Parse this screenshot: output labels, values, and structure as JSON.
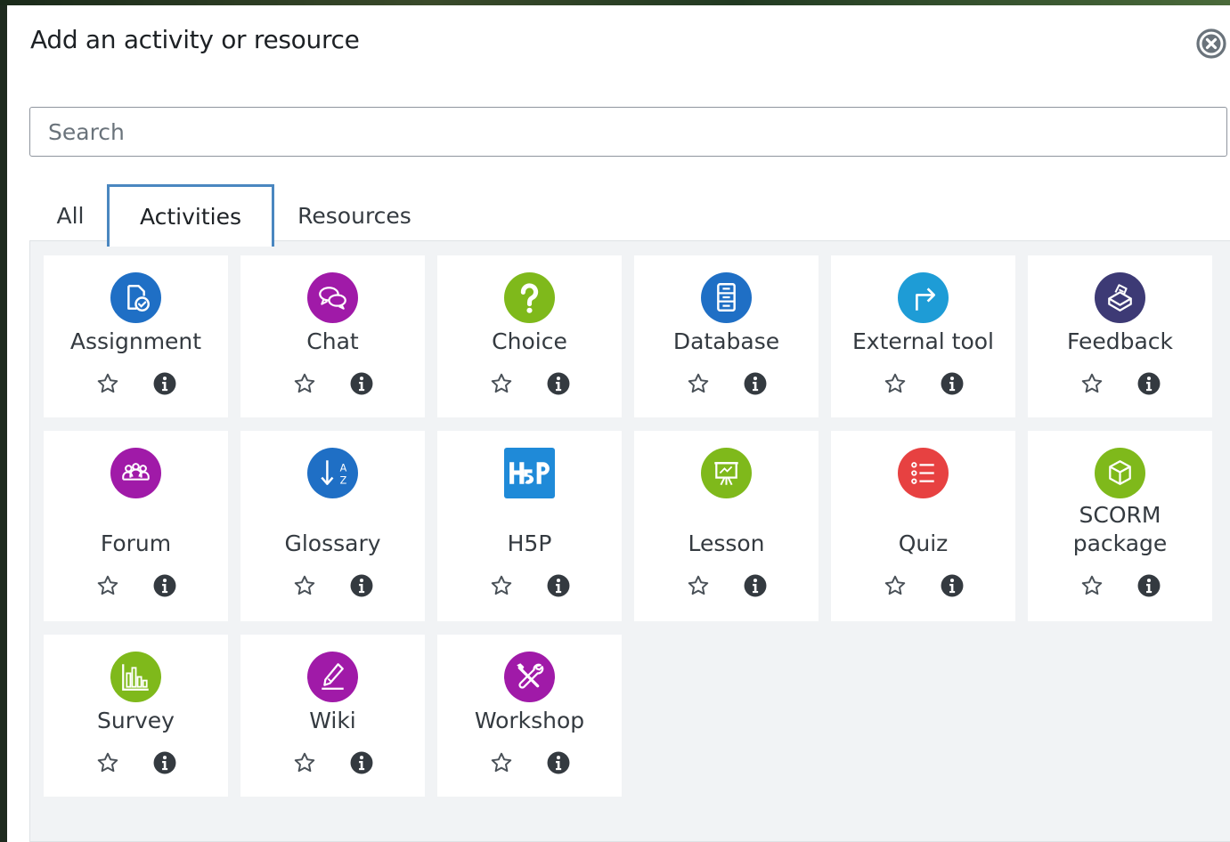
{
  "dialog": {
    "title": "Add an activity or resource",
    "close_icon": "close-circle-icon"
  },
  "search": {
    "placeholder": "Search",
    "value": ""
  },
  "tabs": [
    {
      "label": "All",
      "selected": false
    },
    {
      "label": "Activities",
      "selected": true
    },
    {
      "label": "Resources",
      "selected": false
    }
  ],
  "colors": {
    "assignment": "#1f6fc5",
    "communication": "#a01aa8",
    "choice": "#7fb91b",
    "database": "#1f6fc5",
    "external_tool": "#1e9cd6",
    "feedback": "#3d3a75",
    "quiz": "#e74141",
    "tab_focus": "#4a87c0"
  },
  "activities": [
    {
      "name": "Assignment",
      "icon": "assignment-icon"
    },
    {
      "name": "Chat",
      "icon": "chat-icon"
    },
    {
      "name": "Choice",
      "icon": "choice-icon"
    },
    {
      "name": "Database",
      "icon": "database-icon"
    },
    {
      "name": "External tool",
      "icon": "external-tool-icon"
    },
    {
      "name": "Feedback",
      "icon": "feedback-icon"
    },
    {
      "name": "Forum",
      "icon": "forum-icon"
    },
    {
      "name": "Glossary",
      "icon": "glossary-icon"
    },
    {
      "name": "H5P",
      "icon": "h5p-icon"
    },
    {
      "name": "Lesson",
      "icon": "lesson-icon"
    },
    {
      "name": "Quiz",
      "icon": "quiz-icon"
    },
    {
      "name_line1": "SCORM",
      "name_line2": "package",
      "icon": "scorm-package-icon"
    },
    {
      "name": "Survey",
      "icon": "survey-icon"
    },
    {
      "name": "Wiki",
      "icon": "wiki-icon"
    },
    {
      "name": "Workshop",
      "icon": "workshop-icon"
    }
  ],
  "card_actions": {
    "star_icon": "star-outline-icon",
    "info_icon": "info-icon"
  }
}
